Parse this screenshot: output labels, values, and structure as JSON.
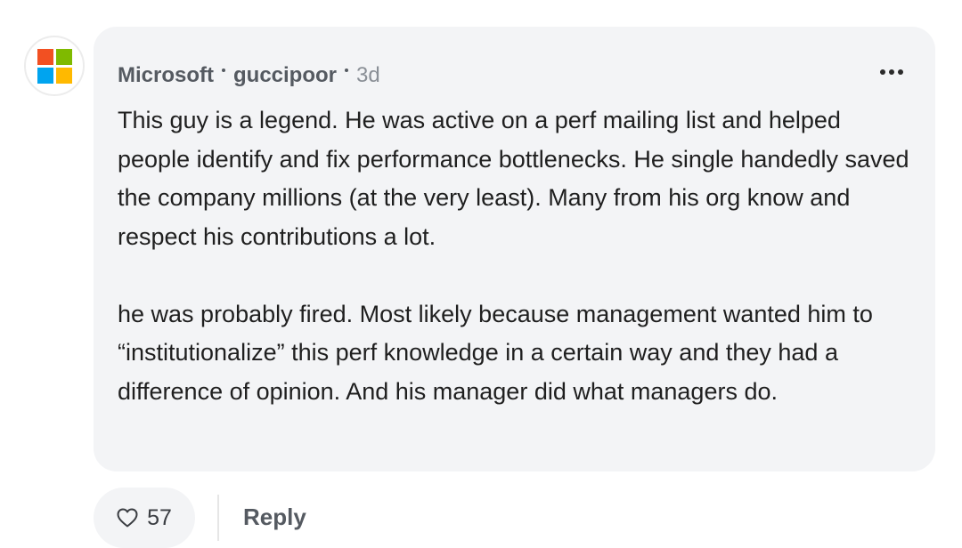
{
  "avatar": {
    "icon": "microsoft-logo-icon",
    "colors": [
      "#f25022",
      "#7fba00",
      "#00a4ef",
      "#ffb900"
    ]
  },
  "comment": {
    "company": "Microsoft",
    "username": "guccipoor",
    "time": "3d",
    "paragraphs": [
      "This guy is a legend. He was active on a perf mailing list and helped people identify and fix performance bottlenecks. He single handedly saved the company millions (at the very least). Many from his org know and respect his contributions a lot.",
      "he was probably fired. Most likely because management wanted him to “institutionalize” this perf knowledge in a certain way and they had a difference of opinion. And his manager did what managers do."
    ],
    "more_icon": "more-horizontal-icon"
  },
  "actions": {
    "like_icon": "heart-outline-icon",
    "like_count": "57",
    "reply_label": "Reply"
  }
}
